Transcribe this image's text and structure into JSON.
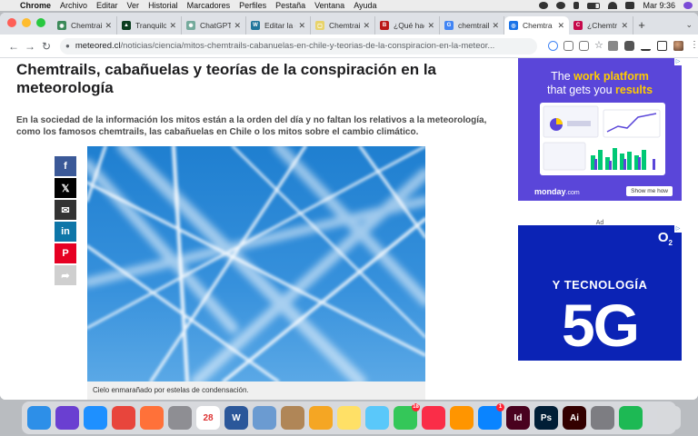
{
  "menubar": {
    "items": [
      "Chrome",
      "Archivo",
      "Editar",
      "Ver",
      "Historial",
      "Marcadores",
      "Perfiles",
      "Pestaña",
      "Ventana",
      "Ayuda"
    ],
    "clock": "Mar 9:36"
  },
  "browser": {
    "tabs": [
      {
        "label": "Chemtrails",
        "fav_color": "#3c8a5a",
        "fav_glyph": "◉"
      },
      {
        "label": "Tranquilo",
        "fav_color": "#0a3d1f",
        "fav_glyph": "▲"
      },
      {
        "label": "ChatGPT",
        "fav_color": "#74aa9c",
        "fav_glyph": "✺"
      },
      {
        "label": "Editar la e",
        "fav_color": "#21759b",
        "fav_glyph": "W"
      },
      {
        "label": "Chemtrails",
        "fav_color": "#e8d36a",
        "fav_glyph": "▢"
      },
      {
        "label": "¿Qué hac",
        "fav_color": "#bb1919",
        "fav_glyph": "B"
      },
      {
        "label": "chemtrails",
        "fav_color": "#4285f4",
        "fav_glyph": "G"
      },
      {
        "label": "Chemtra",
        "fav_color": "#1a73e8",
        "fav_glyph": "◎"
      },
      {
        "label": "¿Chemtr",
        "fav_color": "#c6094b",
        "fav_glyph": "C"
      }
    ],
    "active_tab_index": 7,
    "url_host": "meteored.cl",
    "url_path": "/noticias/ciencia/mitos-chemtrails-cabanuelas-en-chile-y-teorias-de-la-conspiracion-en-la-meteor..."
  },
  "article": {
    "title": "Chemtrails, cabañuelas y teorías de la conspiración en la meteorología",
    "lead": "En la sociedad de la información los mitos están a la orden del día y no faltan los relativos a la meteorología, como los famosos chemtrails, las cabañuelas en Chile o los mitos sobre el cambio climático.",
    "image_caption": "Cielo enmarañado por estelas de condensación."
  },
  "ads": {
    "monday": {
      "headline_pre": "The ",
      "headline_em": "work platform",
      "headline_post": "that gets you ",
      "headline_em2": "results",
      "brand": "monday",
      "brand_suffix": ".com",
      "button": "Show me how"
    },
    "label": "Ad",
    "o2": {
      "logo": "O",
      "logo_sub": "2",
      "headline": "Y TECNOLOGÍA",
      "big": "5G"
    }
  },
  "dock": {
    "apps": [
      {
        "name": "finder-icon",
        "color": "#2d8fe8"
      },
      {
        "name": "siri-icon",
        "color": "#6a3fd1"
      },
      {
        "name": "safari-icon",
        "color": "#1e90ff"
      },
      {
        "name": "chrome-icon",
        "color": "#e8453c"
      },
      {
        "name": "firefox-icon",
        "color": "#ff7139"
      },
      {
        "name": "launchpad-icon",
        "color": "#8e8e93"
      },
      {
        "name": "calendar-icon",
        "color": "#ffffff",
        "text": "28"
      },
      {
        "name": "word-icon",
        "color": "#2b579a",
        "text": "W"
      },
      {
        "name": "preview-icon",
        "color": "#6b9bd1"
      },
      {
        "name": "contacts-icon",
        "color": "#b08657"
      },
      {
        "name": "photos-icon",
        "color": "#f5a623"
      },
      {
        "name": "notes-icon",
        "color": "#ffe066"
      },
      {
        "name": "messages-icon",
        "color": "#5ac8fa"
      },
      {
        "name": "facetime-icon",
        "color": "#34c759",
        "badge": "18"
      },
      {
        "name": "music-icon",
        "color": "#fa2d48"
      },
      {
        "name": "books-icon",
        "color": "#ff9500"
      },
      {
        "name": "appstore-icon",
        "color": "#0a84ff",
        "badge": "1"
      },
      {
        "name": "indesign-icon",
        "color": "#49021f",
        "text": "Id"
      },
      {
        "name": "photoshop-icon",
        "color": "#001e36",
        "text": "Ps"
      },
      {
        "name": "illustrator-icon",
        "color": "#330000",
        "text": "Ai"
      },
      {
        "name": "system-preferences-icon",
        "color": "#7d7d82"
      },
      {
        "name": "spotify-icon",
        "color": "#1db954"
      },
      {
        "name": "trash-icon",
        "color": "#d7d9dc"
      }
    ]
  }
}
